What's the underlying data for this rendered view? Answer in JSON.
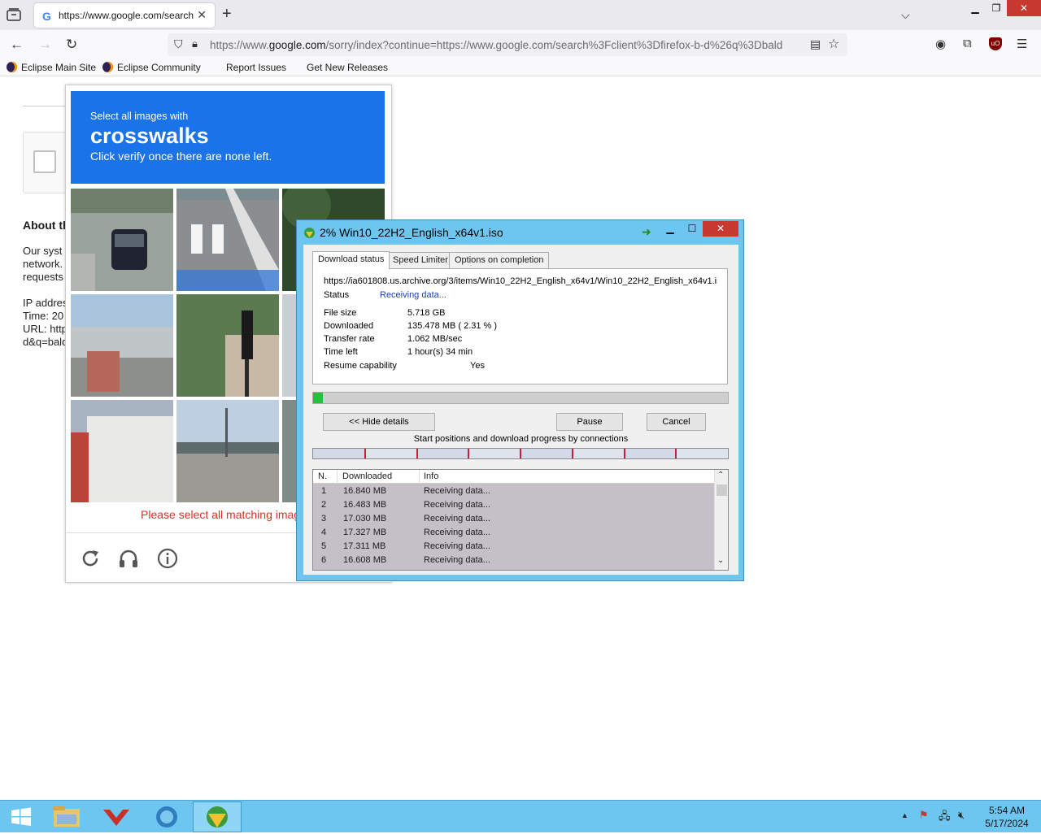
{
  "browser": {
    "tab_title": "https://www.google.com/search",
    "url_prefix": "https://www.",
    "url_domain": "google.com",
    "url_rest": "/sorry/index?continue=https://www.google.com/search%3Fclient%3Dfirefox-b-d%26q%3Dbald",
    "bookmarks": [
      "Eclipse Main Site",
      "Eclipse Community",
      "Report Issues",
      "Get New Releases"
    ]
  },
  "page": {
    "about_heading": "About th",
    "lines1": [
      "Our syst",
      "network.",
      "requests"
    ],
    "lines2": [
      "IP addres",
      "Time: 20",
      "URL: http",
      "d&q=bald"
    ]
  },
  "captcha": {
    "instruction": "Select all images with",
    "target": "crosswalks",
    "hint": "Click verify once there are none left.",
    "error": "Please select all matching images.",
    "icons": [
      "reload-icon",
      "audio-icon",
      "info-icon"
    ]
  },
  "idm": {
    "title": "2% Win10_22H2_English_x64v1.iso",
    "tabs": [
      "Download status",
      "Speed Limiter",
      "Options on completion"
    ],
    "url": "https://ia601808.us.archive.org/3/items/Win10_22H2_English_x64v1/Win10_22H2_English_x64v1.iso",
    "status_label": "Status",
    "status_value": "Receiving data...",
    "file_size_label": "File size",
    "file_size_value": "5.718  GB",
    "downloaded_label": "Downloaded",
    "downloaded_value": "135.478  MB  ( 2.31 % )",
    "transfer_label": "Transfer rate",
    "transfer_value": "1.062  MB/sec",
    "time_left_label": "Time left",
    "time_left_value": "1 hour(s) 34 min",
    "resume_label": "Resume capability",
    "resume_value": "Yes",
    "progress_percent": 2.31,
    "hide_details": "<< Hide details",
    "pause": "Pause",
    "cancel": "Cancel",
    "connections_label": "Start positions and download progress by connections",
    "table_headers": [
      "N.",
      "Downloaded",
      "Info"
    ],
    "connections": [
      {
        "n": "1",
        "downloaded": "16.840  MB",
        "info": "Receiving data..."
      },
      {
        "n": "2",
        "downloaded": "16.483  MB",
        "info": "Receiving data..."
      },
      {
        "n": "3",
        "downloaded": "17.030  MB",
        "info": "Receiving data..."
      },
      {
        "n": "4",
        "downloaded": "17.327  MB",
        "info": "Receiving data..."
      },
      {
        "n": "5",
        "downloaded": "17.311  MB",
        "info": "Receiving data..."
      },
      {
        "n": "6",
        "downloaded": "16.608  MB",
        "info": "Receiving data..."
      }
    ],
    "connection_count": 8
  },
  "taskbar": {
    "time": "5:54 AM",
    "date": "5/17/2024"
  },
  "colors": {
    "captcha_blue": "#1a73e8",
    "idm_frame": "#6dc6ef",
    "progress_green": "#22c33b",
    "close_red": "#c7382f"
  }
}
